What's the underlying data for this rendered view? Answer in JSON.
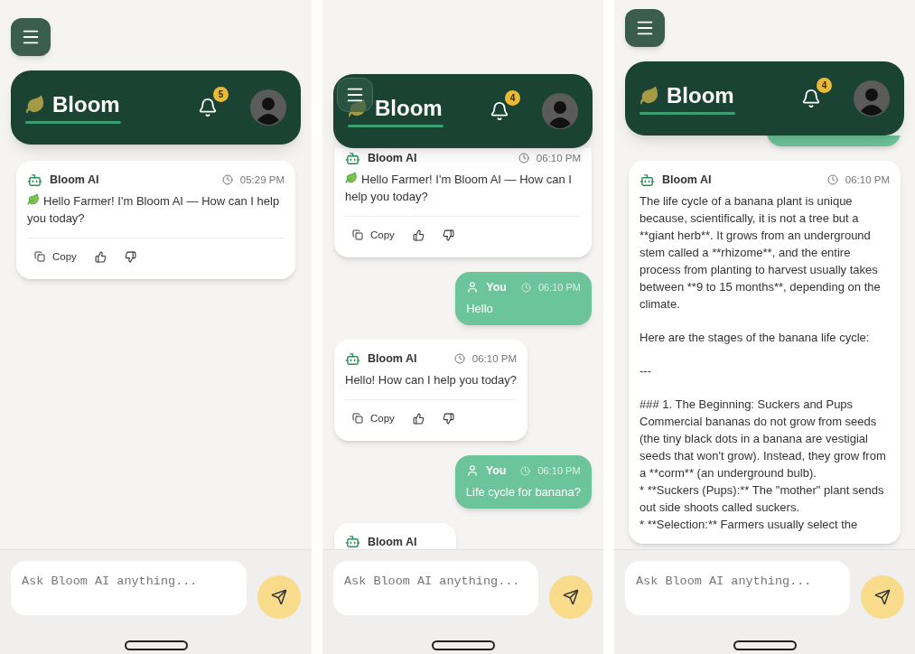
{
  "screens": [
    {
      "menu_over_header": false,
      "header": {
        "title": "Bloom",
        "notifications": "5"
      },
      "messages": [
        {
          "kind": "bot",
          "sender": "Bloom AI",
          "time": "05:29 PM",
          "greeting": true,
          "blocks": [
            [
              "Hello Farmer! I'm Bloom AI — How can I help you today?"
            ]
          ],
          "copy": "Copy"
        }
      ],
      "input": {
        "placeholder": "Ask Bloom AI anything..."
      }
    },
    {
      "menu_over_header": true,
      "header": {
        "title": "Bloom",
        "notifications": "4"
      },
      "messages": [
        {
          "kind": "bot",
          "sender": "Bloom AI",
          "time": "06:10 PM",
          "greeting": true,
          "blocks": [
            [
              "Hello Farmer! I'm Bloom AI — How can I help you today?"
            ]
          ],
          "copy": "Copy"
        },
        {
          "kind": "user",
          "sender": "You",
          "time": "06:10 PM",
          "text": "Hello"
        },
        {
          "kind": "bot",
          "sender": "Bloom AI",
          "time": "06:10 PM",
          "greeting": false,
          "blocks": [
            [
              "Hello! How can I help you today?"
            ]
          ],
          "copy": "Copy"
        },
        {
          "kind": "user",
          "sender": "You",
          "time": "06:10 PM",
          "text": "Life cycle for banana?"
        },
        {
          "kind": "typing",
          "sender": "Bloom AI"
        }
      ],
      "input": {
        "placeholder": "Ask Bloom AI anything..."
      }
    },
    {
      "menu_over_header": false,
      "header": {
        "title": "Bloom",
        "notifications": "4"
      },
      "messages": [
        {
          "kind": "partial"
        },
        {
          "kind": "bot",
          "sender": "Bloom AI",
          "time": "06:10 PM",
          "greeting": false,
          "blocks": [
            [
              "The life cycle of a banana plant is unique because, scientifically, it is not a tree but a **giant herb**. It grows from an underground stem called a **rhizome**, and the entire process from planting to harvest usually takes between **9 to 15 months**, depending on the climate."
            ],
            [
              "Here are the stages of the banana life cycle:"
            ],
            [
              "---"
            ],
            [
              "### 1. The Beginning: Suckers and Pups",
              "Commercial bananas do not grow from seeds (the tiny black dots in a banana are vestigial seeds that won't grow). Instead, they grow from a **corm** (an underground bulb).",
              "*  **Suckers (Pups):** The \"mother\" plant sends out side shoots called suckers.",
              "*  **Selection:** Farmers usually select the"
            ]
          ]
        }
      ],
      "input": {
        "placeholder": "Ask Bloom AI anything..."
      }
    }
  ]
}
